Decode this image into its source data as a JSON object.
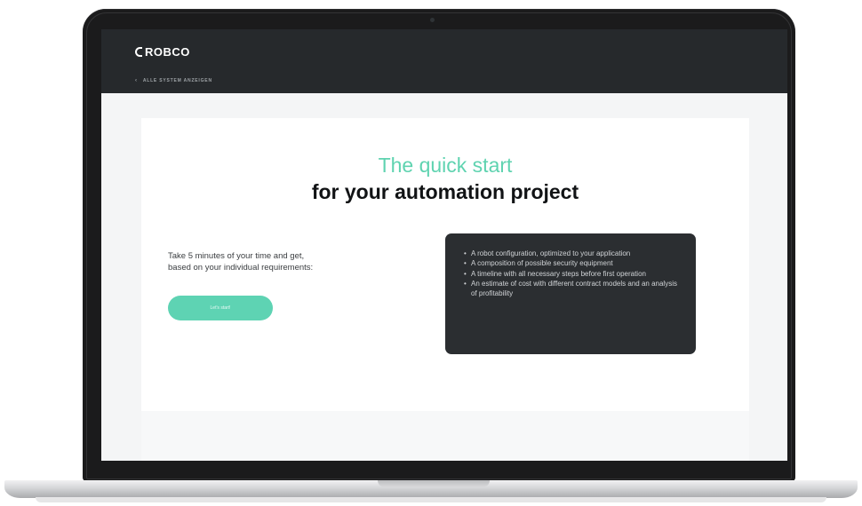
{
  "header": {
    "logo_text": "ROBCO",
    "breadcrumb": "ALLE SYSTEM ANZEIGEN"
  },
  "hero": {
    "headline_accent": "The quick start",
    "headline_main": "for your automation project",
    "intro_line_1": "Take 5 minutes of your time and get,",
    "intro_line_2": "based on your individual requirements:",
    "cta_label": "Let's start!"
  },
  "benefits": [
    "A robot configuration, optimized to your application",
    "A composition of possible security equipment",
    "A timeline with all necessary steps before first operation",
    "An estimate of cost with different contract models and an analysis of profitability"
  ],
  "colors": {
    "accent": "#5fd3b0",
    "header_bg": "#26292c",
    "card_dark": "#2b2e31"
  },
  "icons": {
    "logo_mark": "robco-logo-icon",
    "breadcrumb": "chevron-left-icon"
  }
}
